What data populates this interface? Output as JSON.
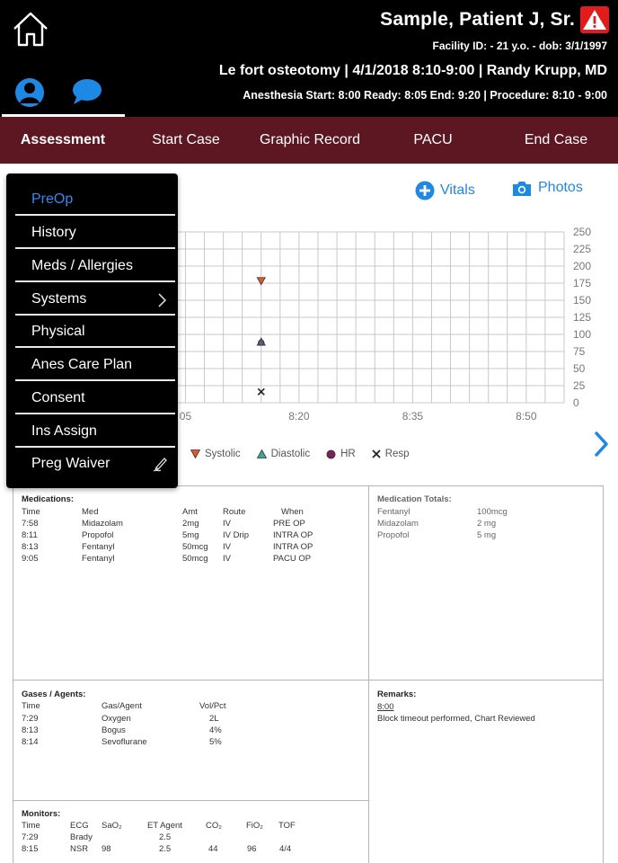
{
  "header": {
    "patient_name": "Sample, Patient  J, Sr.",
    "facility_line": "Facility ID:  - 21 y.o.  - dob: 3/1/1997",
    "case_line": "Le fort osteotomy  |  4/1/2018  8:10-9:00  |  Randy Krupp, MD",
    "times_line": "Anesthesia Start: 8:00    Ready: 8:05    End: 9:20  |  Procedure: 8:10 - 9:00",
    "alert_color": "#e21c1c"
  },
  "nav": {
    "tabs": [
      {
        "label": "Assessment",
        "active": true
      },
      {
        "label": "Start Case",
        "active": false
      },
      {
        "label": "Graphic Record",
        "active": false
      },
      {
        "label": "PACU",
        "active": false
      },
      {
        "label": "End Case",
        "active": false
      }
    ],
    "color": "#5c1722"
  },
  "menu": {
    "items": [
      {
        "label": "PreOp",
        "selected": true,
        "icon": null
      },
      {
        "label": "History",
        "selected": false,
        "icon": null
      },
      {
        "label": "Meds / Allergies",
        "selected": false,
        "icon": null
      },
      {
        "label": "Systems",
        "selected": false,
        "icon": "chevron-right-icon"
      },
      {
        "label": "Physical",
        "selected": false,
        "icon": null
      },
      {
        "label": "Anes Care Plan",
        "selected": false,
        "icon": null
      },
      {
        "label": "Consent",
        "selected": false,
        "icon": null
      },
      {
        "label": "Ins Assign",
        "selected": false,
        "icon": null
      },
      {
        "label": "Preg Waiver",
        "selected": false,
        "icon": "signature-pen-icon"
      }
    ],
    "selected_color": "#2f8bef"
  },
  "toolbar": {
    "vitals_label": "Vitals",
    "photos_label": "Photos",
    "accent": "#1e88e5"
  },
  "chart_data": {
    "type": "scatter",
    "x_ticks": [
      "05",
      "8:20",
      "8:35",
      "8:50"
    ],
    "y_ticks": [
      0,
      25,
      50,
      75,
      100,
      125,
      150,
      175,
      200,
      225,
      250
    ],
    "ylim": [
      0,
      250
    ],
    "grid": true,
    "series": [
      {
        "name": "Systolic",
        "marker": "triangle-down",
        "color": "#e2572b",
        "points": [
          {
            "x": "8:15",
            "y": 178
          }
        ]
      },
      {
        "name": "Diastolic",
        "marker": "triangle-up",
        "color": "#3aa79c",
        "points": [
          {
            "x": "8:15",
            "y": 88
          }
        ]
      },
      {
        "name": "HR",
        "marker": "circle",
        "color": "#7a1f5c",
        "points": [
          {
            "x": "8:15",
            "y": 88
          }
        ]
      },
      {
        "name": "Resp",
        "marker": "x",
        "color": "#222222",
        "points": [
          {
            "x": "8:15",
            "y": 16
          }
        ]
      }
    ]
  },
  "medications": {
    "title": "Medications:",
    "headers": [
      "Time",
      "Med",
      "Amt",
      "Route",
      "When"
    ],
    "rows": [
      [
        "7:58",
        "Midazolam",
        "2mg",
        "IV",
        "PRE OP"
      ],
      [
        "8:11",
        "Propofol",
        "5mg",
        "IV Drip",
        "INTRA OP"
      ],
      [
        "8:13",
        "Fentanyl",
        "50mcg",
        "IV",
        "INTRA OP"
      ],
      [
        "9:05",
        "Fentanyl",
        "50mcg",
        "IV",
        "PACU OP"
      ]
    ]
  },
  "medication_totals": {
    "title": "Medication Totals:",
    "rows": [
      [
        "Fentanyl",
        "100mcg"
      ],
      [
        "Midazolam",
        "2 mg"
      ],
      [
        "Propofol",
        "5 mg"
      ]
    ]
  },
  "gases": {
    "title": "Gases / Agents:",
    "headers": [
      "Time",
      "Gas/Agent",
      "Vol/Pct"
    ],
    "rows": [
      [
        "7:29",
        "Oxygen",
        "2L"
      ],
      [
        "8:13",
        "Bogus",
        "4%"
      ],
      [
        "8:14",
        "Sevoflurane",
        "5%"
      ]
    ]
  },
  "remarks": {
    "title": "Remarks:",
    "time": "8:00",
    "text": "Block timeout performed, Chart Reviewed"
  },
  "monitors": {
    "title": "Monitors:",
    "headers": [
      "Time",
      "ECG",
      "SaO₂",
      "ET Agent",
      "CO₂",
      "FiO₂",
      "TOF"
    ],
    "rows": [
      [
        "7:29",
        "Brady",
        "",
        "2.5",
        "",
        "",
        ""
      ],
      [
        "8:15",
        "NSR",
        "98",
        "2.5",
        "44",
        "96",
        "4/4"
      ]
    ]
  }
}
